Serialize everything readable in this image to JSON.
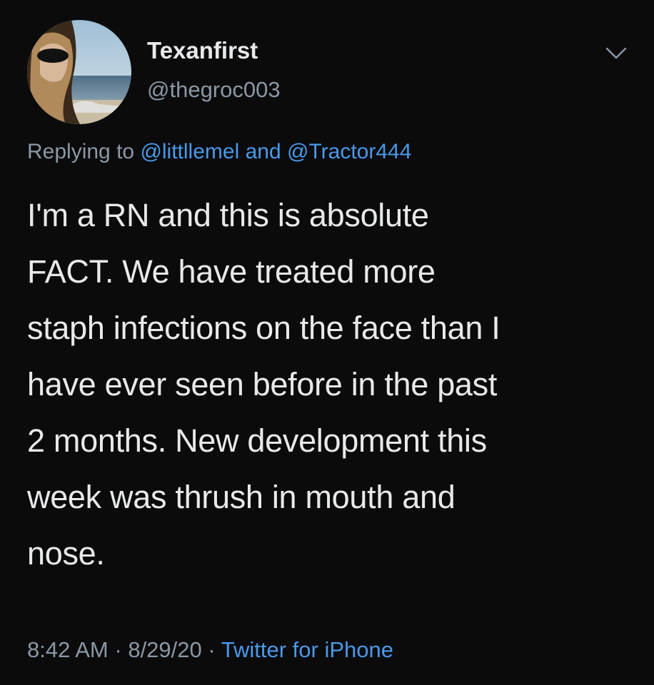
{
  "colors": {
    "background": "#0b0b0c",
    "text": "#e7e9ea",
    "muted": "#8b98a5",
    "link": "#4a99e9"
  },
  "user": {
    "display_name": "Texanfirst",
    "handle": "@thegroc003",
    "avatar_icon": "profile-photo"
  },
  "menu_icon": "chevron-down-icon",
  "reply": {
    "prefix": "Replying to",
    "mention_1": "@littllemel",
    "conjunction": "and",
    "mention_2": "@Tractor444"
  },
  "tweet": {
    "lines": [
      "I'm a RN and this is absolute",
      "FACT. We have treated more",
      "staph infections on the face than I",
      "have ever seen before in the past",
      "2 months. New development this",
      "week was thrush in mouth and",
      "nose."
    ]
  },
  "meta": {
    "time": "8:42 AM",
    "separator": "·",
    "date": "8/29/20",
    "source": "Twitter for iPhone"
  }
}
